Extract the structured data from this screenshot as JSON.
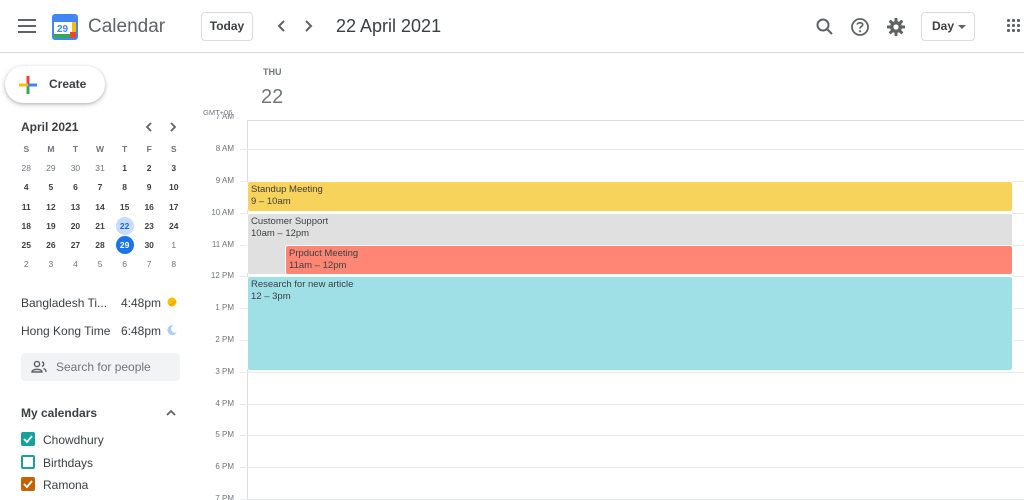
{
  "app": {
    "title": "Calendar",
    "logo_day": "29"
  },
  "toolbar": {
    "today_label": "Today",
    "date_title": "22 April 2021",
    "view_label": "Day"
  },
  "sidebar": {
    "create_label": "Create",
    "mini_calendar": {
      "month_label": "April 2021",
      "weekday_headers": [
        "S",
        "M",
        "T",
        "W",
        "T",
        "F",
        "S"
      ],
      "weeks": [
        [
          {
            "d": "28",
            "o": true
          },
          {
            "d": "29",
            "o": true
          },
          {
            "d": "30",
            "o": true
          },
          {
            "d": "31",
            "o": true
          },
          {
            "d": "1"
          },
          {
            "d": "2"
          },
          {
            "d": "3"
          }
        ],
        [
          {
            "d": "4"
          },
          {
            "d": "5"
          },
          {
            "d": "6"
          },
          {
            "d": "7"
          },
          {
            "d": "8"
          },
          {
            "d": "9"
          },
          {
            "d": "10"
          }
        ],
        [
          {
            "d": "11"
          },
          {
            "d": "12"
          },
          {
            "d": "13"
          },
          {
            "d": "14"
          },
          {
            "d": "15"
          },
          {
            "d": "16"
          },
          {
            "d": "17"
          }
        ],
        [
          {
            "d": "18"
          },
          {
            "d": "19"
          },
          {
            "d": "20"
          },
          {
            "d": "21"
          },
          {
            "d": "22",
            "s": true
          },
          {
            "d": "23"
          },
          {
            "d": "24"
          }
        ],
        [
          {
            "d": "25"
          },
          {
            "d": "26"
          },
          {
            "d": "27"
          },
          {
            "d": "28"
          },
          {
            "d": "29",
            "t": true
          },
          {
            "d": "30"
          },
          {
            "d": "1",
            "o": true
          }
        ],
        [
          {
            "d": "2",
            "o": true
          },
          {
            "d": "3",
            "o": true
          },
          {
            "d": "4",
            "o": true
          },
          {
            "d": "5",
            "o": true
          },
          {
            "d": "6",
            "o": true
          },
          {
            "d": "7",
            "o": true
          },
          {
            "d": "8",
            "o": true
          }
        ]
      ]
    },
    "world_clock": [
      {
        "name": "Bangladesh Ti...",
        "time": "4:48pm",
        "icon": "sun-icon",
        "color": "#fbbc04"
      },
      {
        "name": "Hong Kong Time",
        "time": "6:48pm",
        "icon": "moon-icon",
        "color": "#aecbfa"
      }
    ],
    "search_people_placeholder": "Search for people",
    "my_calendars": {
      "title": "My calendars",
      "items": [
        {
          "name": "Chowdhury",
          "checked": true,
          "color": "#16a29b"
        },
        {
          "name": "Birthdays",
          "checked": false,
          "color": "#16a29b"
        },
        {
          "name": "Ramona",
          "checked": true,
          "color": "#c26401"
        }
      ]
    }
  },
  "day_view": {
    "weekday": "THU",
    "day_number": "22",
    "timezone_label": "GMT+06",
    "hour_labels": [
      "7 AM",
      "8 AM",
      "9 AM",
      "10 AM",
      "11 AM",
      "12 PM",
      "1 PM",
      "2 PM",
      "3 PM",
      "4 PM",
      "5 PM",
      "6 PM",
      "7 PM"
    ],
    "events": [
      {
        "title": "Standup Meeting",
        "time": "9 – 10am",
        "color": "#f8d35b"
      },
      {
        "title": "Customer Support",
        "time": "10am – 12pm",
        "color": "#e0e0e0"
      },
      {
        "title": "Prpduct Meeting",
        "time": "11am – 12pm",
        "color": "#ff8674"
      },
      {
        "title": "Research for new article",
        "time": "12 – 3pm",
        "color": "#9fdfe6"
      }
    ]
  }
}
